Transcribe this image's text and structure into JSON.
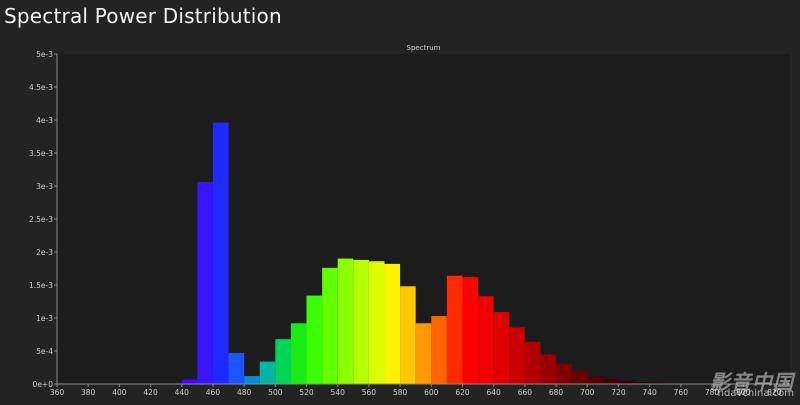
{
  "page": {
    "title": "Spectral Power Distribution"
  },
  "chart_data": {
    "type": "bar",
    "title": "Spectrum",
    "xlabel": "",
    "ylabel": "",
    "xlim": [
      360,
      830
    ],
    "ylim": [
      0,
      0.005
    ],
    "x_ticks": [
      360,
      380,
      400,
      420,
      440,
      460,
      480,
      500,
      520,
      540,
      560,
      580,
      600,
      620,
      640,
      660,
      680,
      700,
      720,
      740,
      760,
      780,
      800,
      820
    ],
    "y_ticks": [
      {
        "value": 0,
        "label": "0e+0"
      },
      {
        "value": 0.0005,
        "label": "5e-4"
      },
      {
        "value": 0.001,
        "label": "1e-3"
      },
      {
        "value": 0.0015,
        "label": "1.5e-3"
      },
      {
        "value": 0.002,
        "label": "2e-3"
      },
      {
        "value": 0.0025,
        "label": "2.5e-3"
      },
      {
        "value": 0.003,
        "label": "3e-3"
      },
      {
        "value": 0.0035,
        "label": "3.5e-3"
      },
      {
        "value": 0.004,
        "label": "4e-3"
      },
      {
        "value": 0.0045,
        "label": "4.5e-3"
      },
      {
        "value": 0.005,
        "label": "5e-3"
      }
    ],
    "bin_width": 10,
    "bins": [
      {
        "start": 440,
        "value": 7e-05,
        "color": "#4a00ff"
      },
      {
        "start": 450,
        "value": 0.00306,
        "color": "#3a14ff"
      },
      {
        "start": 460,
        "value": 0.00396,
        "color": "#1e2aff"
      },
      {
        "start": 470,
        "value": 0.00047,
        "color": "#1a55ff"
      },
      {
        "start": 480,
        "value": 0.00012,
        "color": "#0090d8"
      },
      {
        "start": 490,
        "value": 0.00034,
        "color": "#00b6a2"
      },
      {
        "start": 500,
        "value": 0.00068,
        "color": "#00d55a"
      },
      {
        "start": 510,
        "value": 0.00092,
        "color": "#18ec14"
      },
      {
        "start": 520,
        "value": 0.00134,
        "color": "#3bff00"
      },
      {
        "start": 530,
        "value": 0.00176,
        "color": "#62ff00"
      },
      {
        "start": 540,
        "value": 0.0019,
        "color": "#8aff00"
      },
      {
        "start": 550,
        "value": 0.00188,
        "color": "#b4ff00"
      },
      {
        "start": 560,
        "value": 0.00186,
        "color": "#dcff00"
      },
      {
        "start": 570,
        "value": 0.00182,
        "color": "#fff200"
      },
      {
        "start": 580,
        "value": 0.00148,
        "color": "#ffc800"
      },
      {
        "start": 590,
        "value": 0.00092,
        "color": "#ff9a00"
      },
      {
        "start": 600,
        "value": 0.00103,
        "color": "#ff6400"
      },
      {
        "start": 610,
        "value": 0.00164,
        "color": "#ff2a00"
      },
      {
        "start": 620,
        "value": 0.00162,
        "color": "#ff0000"
      },
      {
        "start": 630,
        "value": 0.00133,
        "color": "#f00000"
      },
      {
        "start": 640,
        "value": 0.00109,
        "color": "#e00000"
      },
      {
        "start": 650,
        "value": 0.00086,
        "color": "#c80000"
      },
      {
        "start": 660,
        "value": 0.00064,
        "color": "#b00000"
      },
      {
        "start": 670,
        "value": 0.00045,
        "color": "#960000"
      },
      {
        "start": 680,
        "value": 0.00031,
        "color": "#7e0000"
      },
      {
        "start": 690,
        "value": 0.0002,
        "color": "#680000"
      },
      {
        "start": 700,
        "value": 0.00012,
        "color": "#540000"
      },
      {
        "start": 710,
        "value": 8e-05,
        "color": "#460000"
      },
      {
        "start": 720,
        "value": 5e-05,
        "color": "#3a0000"
      },
      {
        "start": 730,
        "value": 3e-05,
        "color": "#320000"
      },
      {
        "start": 740,
        "value": 2e-05,
        "color": "#2c0000"
      },
      {
        "start": 750,
        "value": 1e-05,
        "color": "#280000"
      }
    ],
    "grid": false,
    "legend": "none"
  },
  "watermark": {
    "logo_text": "影音中国",
    "url_text": "hdavchina.com"
  },
  "colors": {
    "background": "#232323",
    "plot_background": "#1c1c1c",
    "axis": "#8c8c8c",
    "text": "#cfcfcf"
  }
}
